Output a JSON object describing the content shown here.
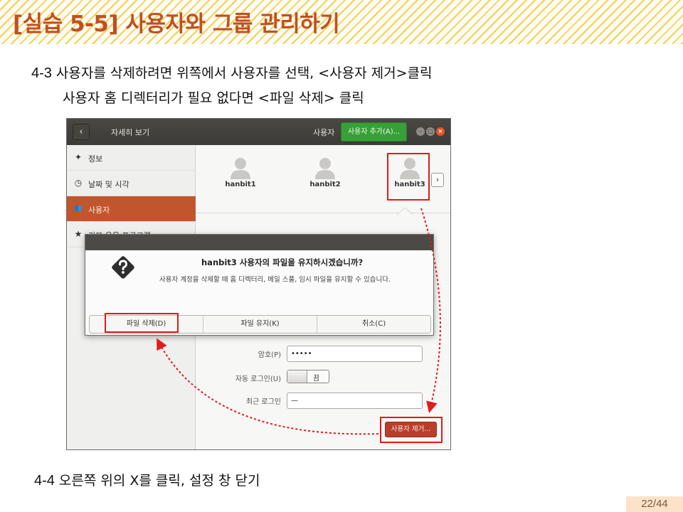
{
  "slide": {
    "title": "[실습 5-5] 사용자와 그룹 관리하기",
    "page": "22/44"
  },
  "steps": [
    {
      "num": "4-3",
      "text": "사용자를 삭제하려면 위쪽에서 사용자를 선택, <사용자 제거>클릭"
    },
    {
      "num": "",
      "text": "사용자 홈 디렉터리가 필요 없다면 <파일 삭제> 클릭"
    },
    {
      "num": "4-4",
      "text": "오른쪽 위의 X를 클릭, 설정 창 닫기"
    }
  ],
  "window": {
    "back_icon": "‹",
    "title": "자세히 보기",
    "section_label": "사용자",
    "add_user_label": "사용자 추가(A)...",
    "min_icon": "–",
    "max_icon": "□",
    "close_icon": "×"
  },
  "sidebar": {
    "items": [
      {
        "icon": "✦",
        "icon_name": "info-icon",
        "label": "정보"
      },
      {
        "icon": "◷",
        "icon_name": "clock-icon",
        "label": "날짜 및 시각"
      },
      {
        "icon": "👥",
        "icon_name": "users-icon",
        "label": "사용자",
        "active": true
      },
      {
        "icon": "★",
        "icon_name": "star-icon",
        "label": "기본 응용 프로그램"
      }
    ]
  },
  "users": [
    "hanbit1",
    "hanbit2",
    "hanbit3"
  ],
  "user_next_icon": "›",
  "form": {
    "password_label": "암호(P)",
    "password_value": "•••••",
    "auto_login_label": "자동 로그인(U)",
    "auto_login_state": "끔",
    "last_login_label": "최근 로그인",
    "last_login_value": "—",
    "remove_user_label": "사용자 제거..."
  },
  "dialog": {
    "title": "hanbit3 사용자의 파일을 유지하시겠습니까?",
    "body": "사용자 계정을 삭제할 때 홈 디렉터리, 메일 스풀, 임시 파일을 유지할 수 있습니다.",
    "buttons": [
      "파일 삭제(D)",
      "파일 유지(K)",
      "취소(C)"
    ]
  },
  "colors": {
    "title_text": "#c0501f",
    "header_stripe": "#f2cf5e",
    "add_button": "#38a038",
    "sidebar_active": "#c1562e",
    "remove_button": "#b83e2c",
    "annotation_red": "#e21b1b"
  }
}
